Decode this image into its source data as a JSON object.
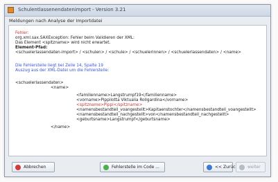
{
  "window": {
    "title": "Schulentlassenendatenimport - Version 3.21"
  },
  "header": {
    "subtitle": "Meldungen nach Analyse der Importdatei"
  },
  "messages": {
    "error_label": "Fehler:",
    "error_1": "org.xml.sax.SAXException: Fehler beim Validieren der XML:",
    "error_2": "Das Element <spitzname> wird nicht erwartet.",
    "element_label": "Element-Pfad:",
    "path": "<schuelerlassendaten-import> / <schulen> / <schule> / <schuelerinnen> / <schuelerlassendaten> / <name>",
    "error_location": "Die Fehlerstelle liegt bei Zeile 14, Spalte 19",
    "excerpt_label": "Auszug aus der XML-Datei um die Fehlerstelle:"
  },
  "xml": {
    "open_root": "<schuelerlassendaten>",
    "open_name": "<name>",
    "line_1": "<familienname>Langstrumpf19</familienname>",
    "line_2": "<vorname>Pippilotta Viktualia Rollgardina</vorname>",
    "line_error": "<spitzname>Pippi</spitzname>",
    "line_3": "<namensbestandteil_voangestellt>Kapitaenstochter</namensbestandteil_voangestellt>",
    "line_4": "<namensbestandteil_nachgestellt>von</namensbestandteil_nachgestellt>",
    "line_5": "<geburtsname>Langstrumpf</geburtsname>",
    "close_name": "</name>"
  },
  "buttons": {
    "cancel": "Abbrechen",
    "show_error": "Fehlerstelle im Code ...",
    "back": "<< Zurück",
    "next": "weiter"
  },
  "colors": {
    "cancel_icon": "#d23b3b",
    "show_error_icon": "#4caf50",
    "back_icon": "#3a7bd5",
    "next_icon": "#b7bcc4"
  }
}
